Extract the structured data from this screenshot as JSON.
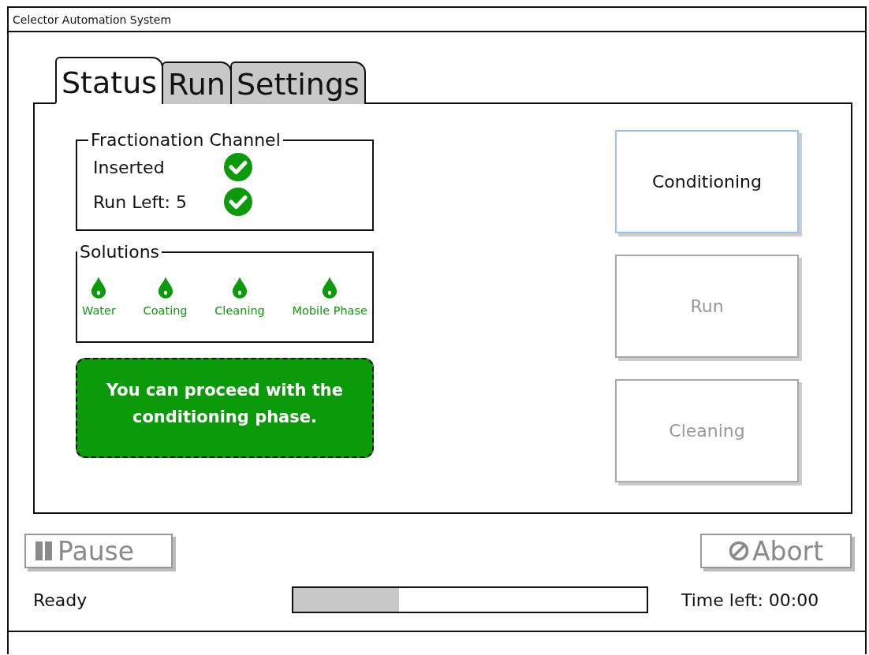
{
  "window": {
    "title": "Celector Automation System"
  },
  "tabs": [
    {
      "label": "Status",
      "selected": true
    },
    {
      "label": "Run",
      "selected": false
    },
    {
      "label": "Settings",
      "selected": false
    }
  ],
  "channel_group": {
    "title": "Fractionation Channel",
    "items": [
      {
        "label": "Inserted",
        "ok": true
      },
      {
        "label": "Run Left: 5",
        "ok": true
      }
    ]
  },
  "solutions_group": {
    "title": "Solutions",
    "items": [
      {
        "label": "Water",
        "available": true
      },
      {
        "label": "Coating",
        "available": true
      },
      {
        "label": "Cleaning",
        "available": true
      },
      {
        "label": "Mobile Phase",
        "available": true
      }
    ]
  },
  "message": {
    "text": "You can proceed with the conditioning phase."
  },
  "phase_buttons": [
    {
      "label": "Conditioning",
      "disabled": false,
      "selected": true
    },
    {
      "label": "Run",
      "disabled": true,
      "selected": false
    },
    {
      "label": "Cleaning",
      "disabled": true,
      "selected": false
    }
  ],
  "pause_button": {
    "label": "Pause",
    "disabled": true
  },
  "abort_button": {
    "label": "Abort",
    "disabled": true
  },
  "status_bar": {
    "status": "Ready",
    "progress": {
      "level": 0.3
    },
    "time_left": "Time left: 00:00"
  }
}
